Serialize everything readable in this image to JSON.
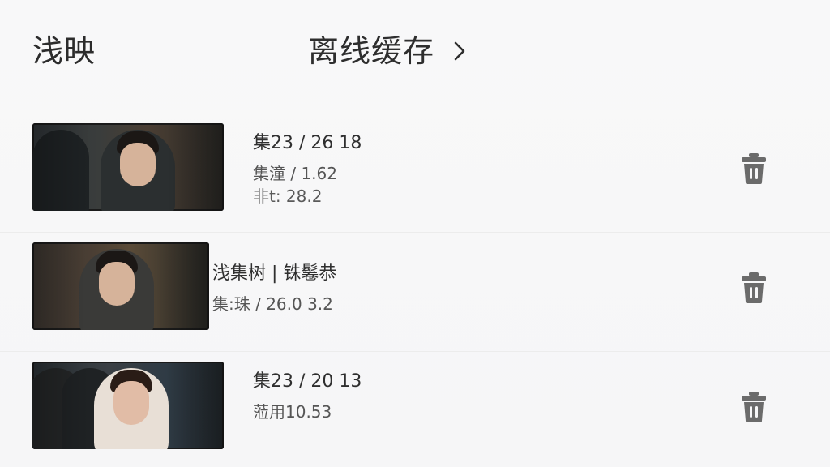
{
  "header": {
    "app_title": "浅映",
    "section_title": "离线缓存"
  },
  "icons": {
    "section_arrow": "chevron-right-icon",
    "delete": "trash-icon"
  },
  "downloads": [
    {
      "title": "集23 / 26 18",
      "meta1": "集潼 / 1.62",
      "meta2": "非t: 28.2"
    },
    {
      "title": "浅集树 | 铢鬈恭",
      "meta1": "集:珠 / 26.0 3.2",
      "meta2": ""
    },
    {
      "title": "集23 / 20 13",
      "meta1": "蒞用10.53",
      "meta2": ""
    }
  ],
  "colors": {
    "icon_gray": "#6b6b6b",
    "text_primary": "#2f2f2f"
  }
}
